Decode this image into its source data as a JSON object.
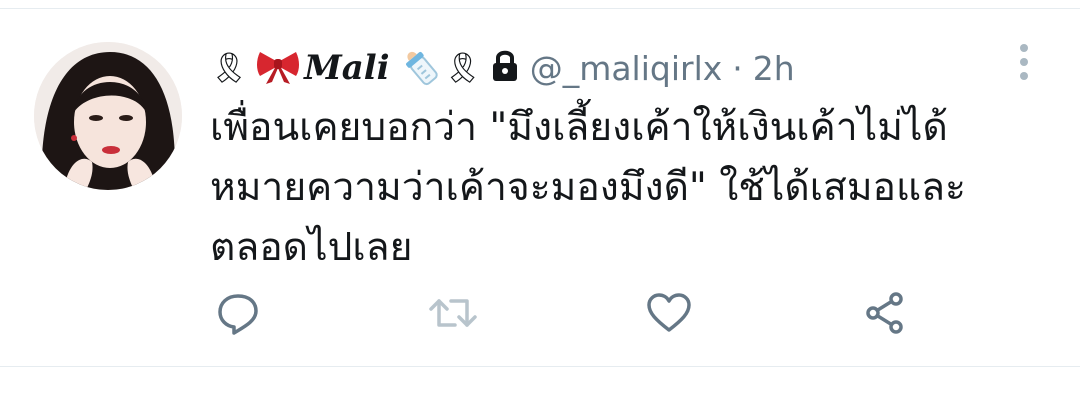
{
  "tweet": {
    "author": {
      "decor_left": "🎗",
      "display_name": "Mali",
      "decor_right": "🎗",
      "handle": "@_maliqirlx",
      "separator": "·",
      "time": "2h",
      "protected": true
    },
    "text": "เพื่อนเคยบอกว่า \"มึงเลี้ยงเค้าให้เงินเค้าไม่ได้\nหมายความว่าเค้าจะมองมึงดี\" ใช้ได้เสมอและ\nตลอดไปเลย",
    "icons": {
      "more": "more-vertical-icon",
      "reply": "reply-icon",
      "retweet": "retweet-icon",
      "like": "heart-icon",
      "share": "share-icon",
      "bow": "ribbon-bow-icon",
      "bottle": "baby-bottle-icon",
      "lock": "lock-icon"
    },
    "colors": {
      "text": "#14171a",
      "muted": "#657786",
      "icon": "#657786",
      "divider": "#e6ecf0",
      "retweet_disabled": "#b8c4cc"
    }
  }
}
